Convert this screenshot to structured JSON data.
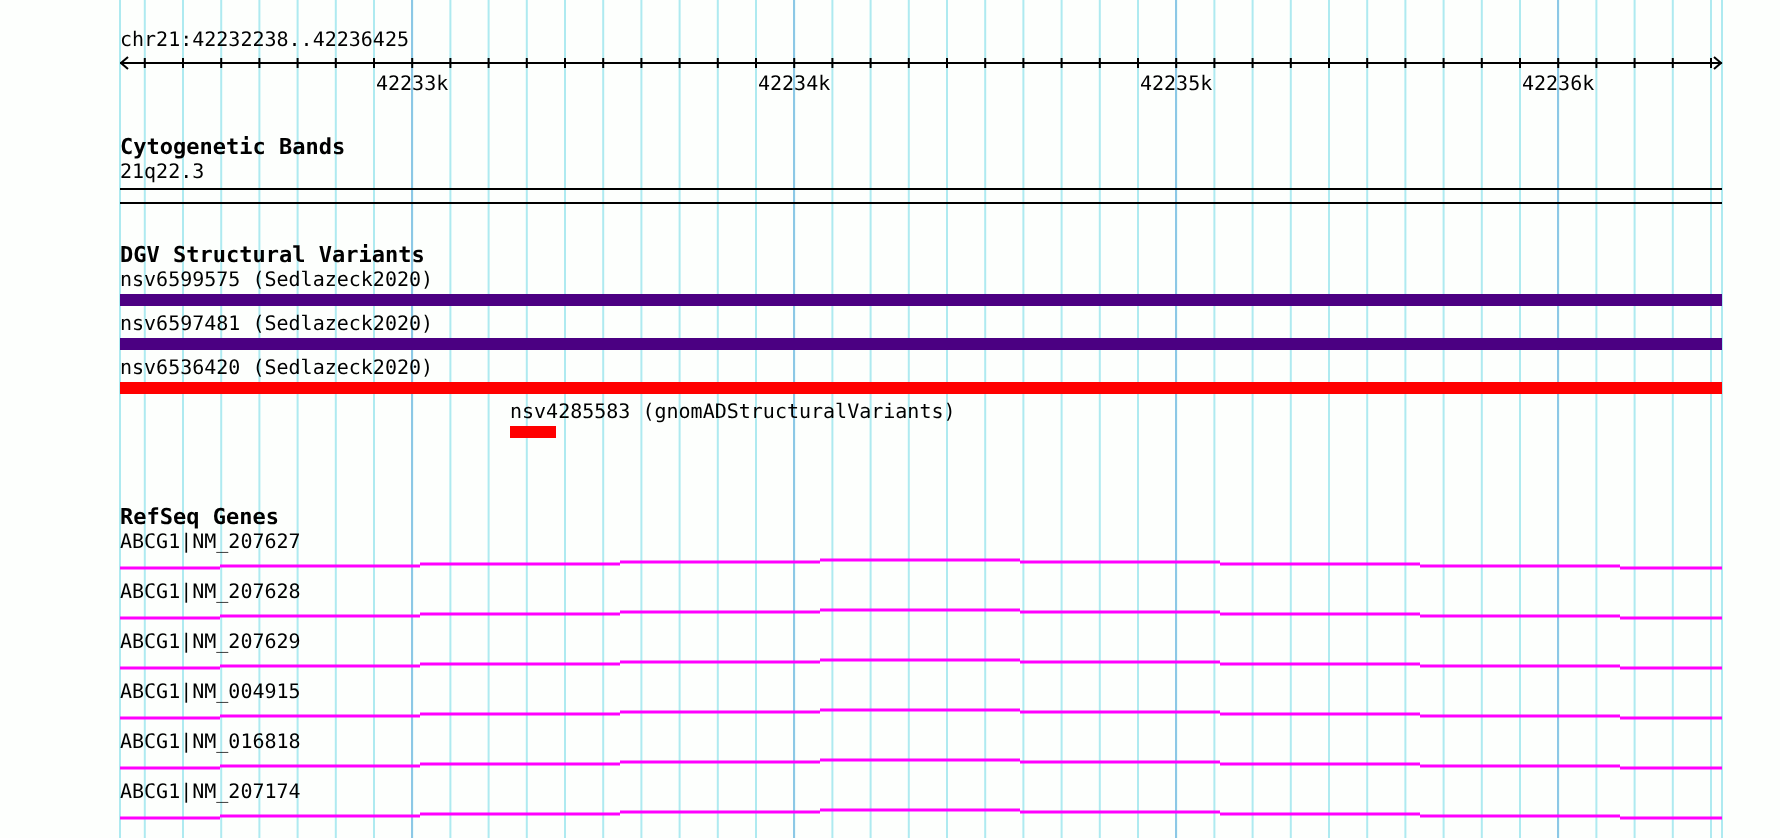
{
  "ruler": {
    "label": "chr21:42232238..42236425",
    "ticks": [
      "42233k",
      "42234k",
      "42235k",
      "42236k"
    ]
  },
  "tracks": [
    {
      "title": "Cytogenetic Bands",
      "kind": "bands",
      "features": [
        {
          "label": "21q22.3"
        }
      ]
    },
    {
      "title": "DGV Structural Variants",
      "kind": "variants",
      "features": [
        {
          "label": "nsv6599575 (Sedlazeck2020)",
          "color": "#4b0082",
          "kind": "spanning"
        },
        {
          "label": "nsv6597481 (Sedlazeck2020)",
          "color": "#4b0082",
          "kind": "spanning"
        },
        {
          "label": "nsv6536420 (Sedlazeck2020)",
          "color": "#ff0000",
          "kind": "spanning"
        },
        {
          "label": "nsv4285583 (gnomADStructuralVariants)",
          "color": "#ff0000",
          "kind": "local"
        }
      ]
    },
    {
      "title": "RefSeq Genes",
      "kind": "genes",
      "features": [
        {
          "label": "ABCG1|NM_207627"
        },
        {
          "label": "ABCG1|NM_207628"
        },
        {
          "label": "ABCG1|NM_207629"
        },
        {
          "label": "ABCG1|NM_004915"
        },
        {
          "label": "ABCG1|NM_016818"
        },
        {
          "label": "ABCG1|NM_207174"
        }
      ]
    }
  ]
}
